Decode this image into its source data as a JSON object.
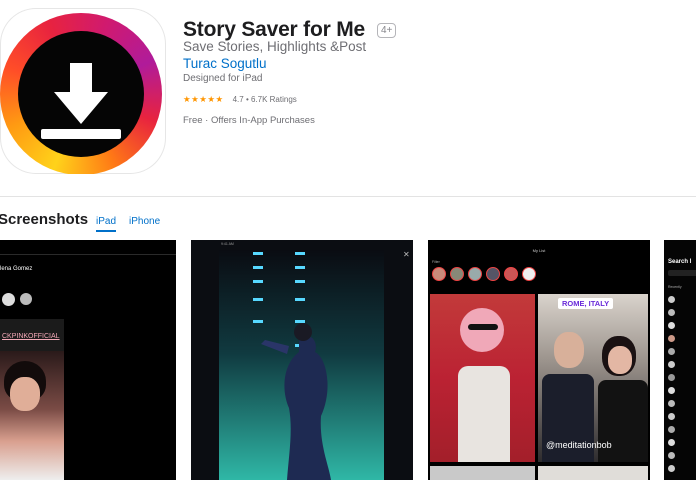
{
  "app": {
    "title": "Story Saver for Me",
    "age_rating": "4+",
    "subtitle": "Save Stories, Highlights &Post",
    "developer": "Turac Sogutlu",
    "designed_for": "Designed for iPad",
    "rating": 4.7,
    "rating_text": "4.7 • 6.7K Ratings",
    "price": "Free · Offers In-App Purchases"
  },
  "screenshots": {
    "heading": "Screenshots",
    "tabs": [
      "iPad",
      "iPhone"
    ],
    "shot1": {
      "profile_name": "lena Gomez",
      "banner": "CKPINKOFFICIAL"
    },
    "shot3": {
      "nav_title": "My List",
      "filter_label": "Filter",
      "location_tag": "ROME, ITALY",
      "watermark": "@meditationbob"
    },
    "shot4": {
      "search_label": "Search I",
      "recently_label": "Recently"
    }
  },
  "colors": {
    "link": "#0070c9",
    "star": "#ff9500",
    "text_secondary": "#6e6e73"
  }
}
